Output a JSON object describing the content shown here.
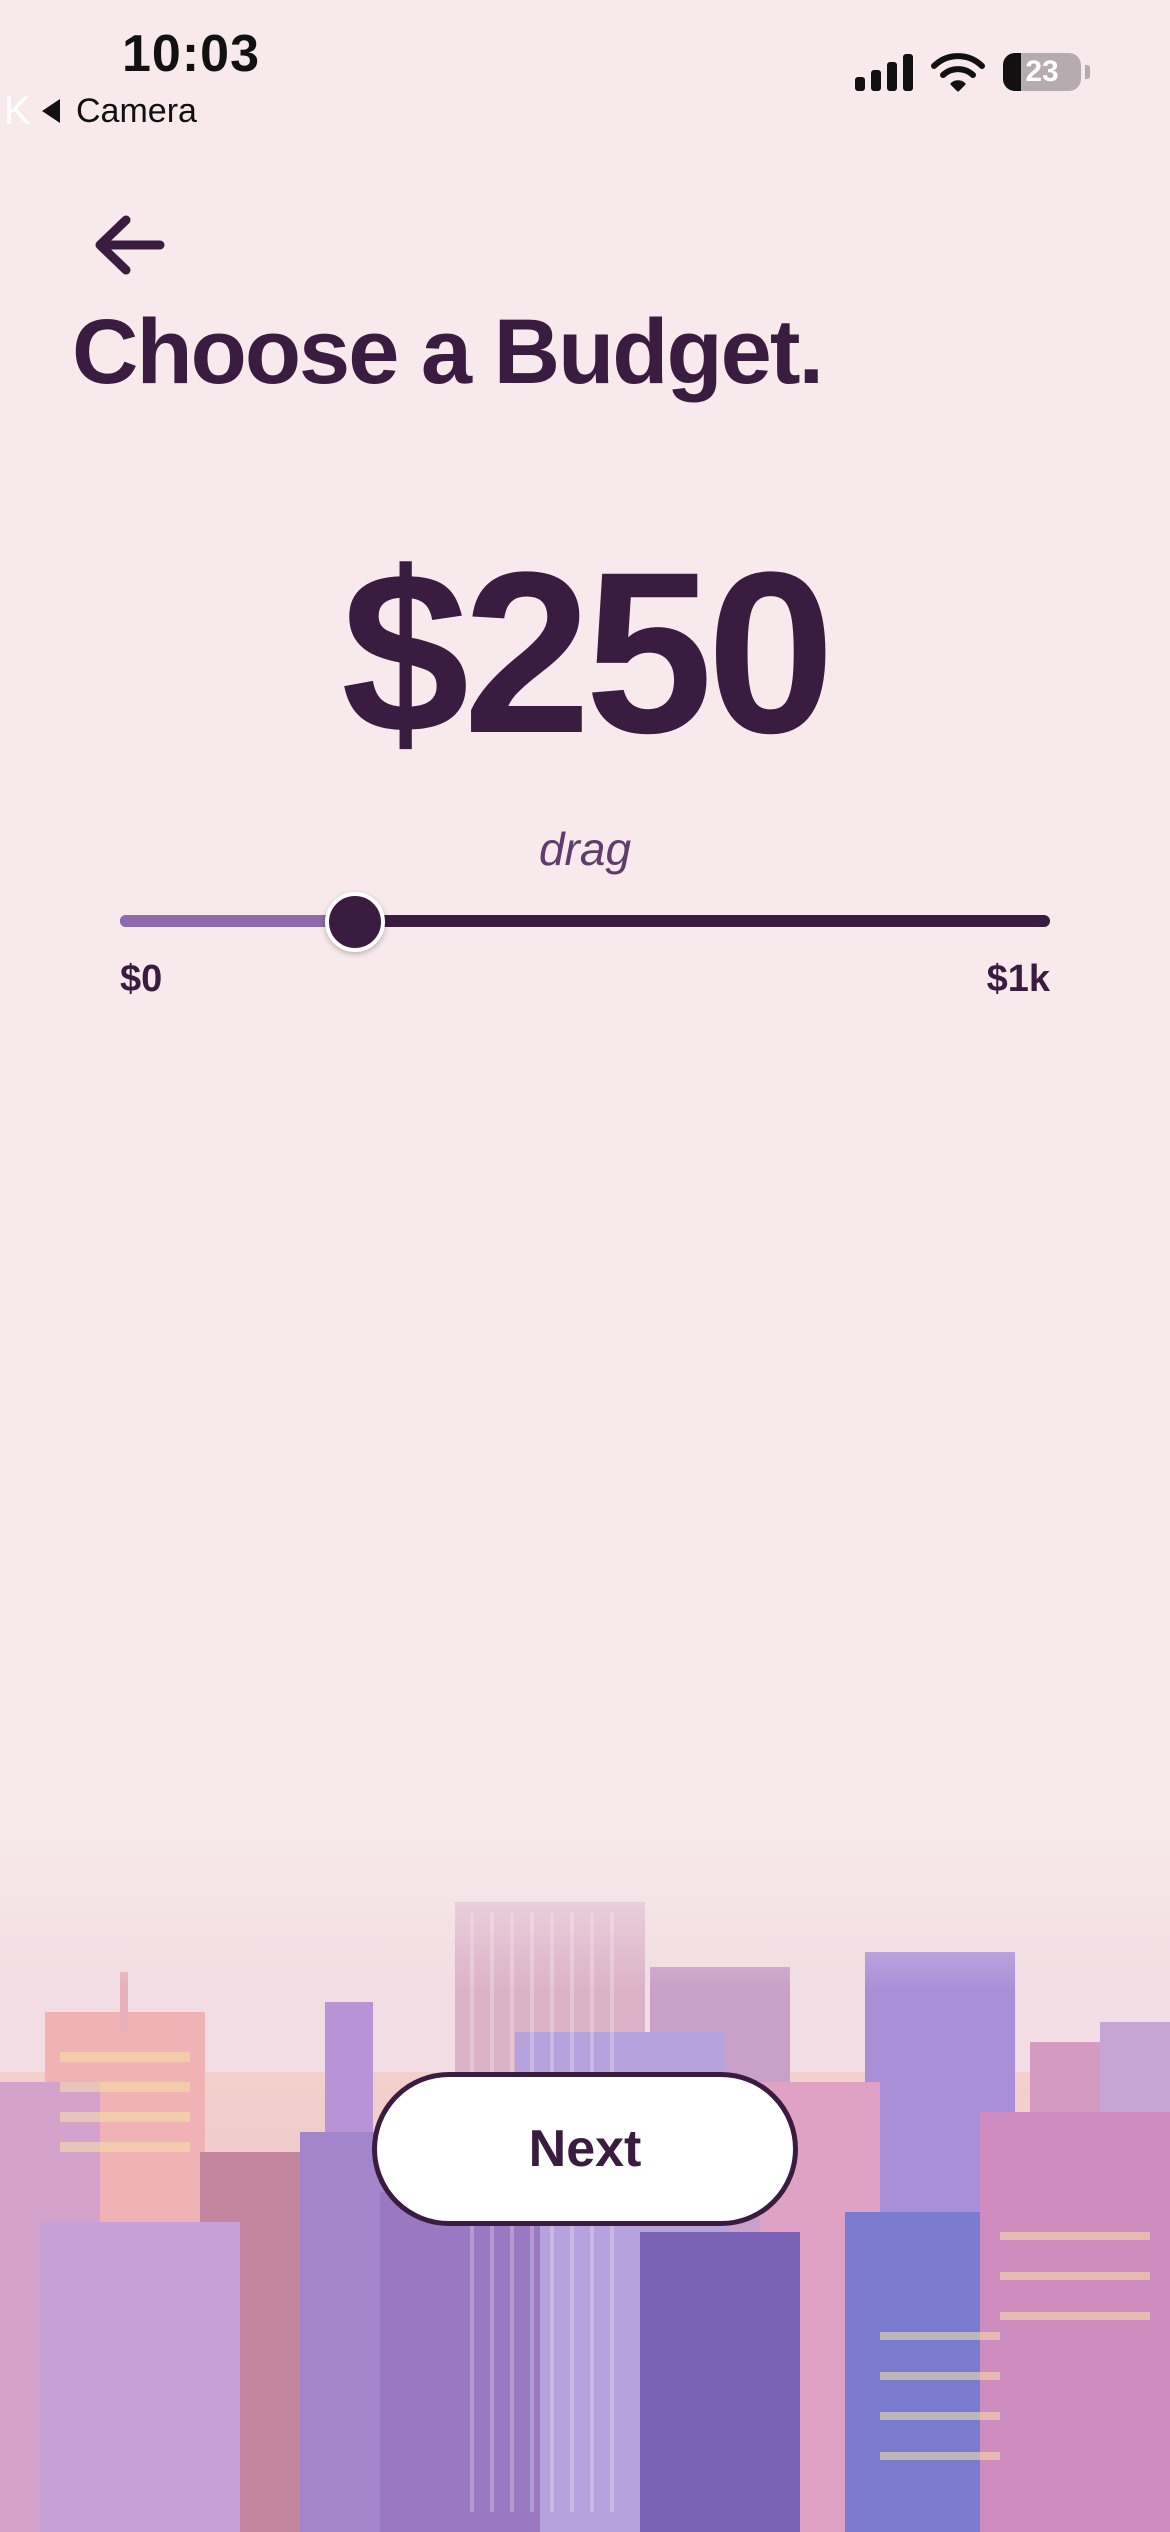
{
  "status_bar": {
    "time": "10:03",
    "back_app": "Camera",
    "back_glyph": "K",
    "battery_percent": "23",
    "battery_level": 0.23
  },
  "screen": {
    "title": "Choose a Budget.",
    "amount": "$250",
    "drag_hint": "drag"
  },
  "slider": {
    "value": 250,
    "min": 0,
    "max": 1000,
    "min_label": "$0",
    "max_label": "$1k"
  },
  "actions": {
    "next_label": "Next"
  },
  "icons": {
    "back": "arrow-left-icon",
    "signal": "cellular-signal-icon",
    "wifi": "wifi-icon",
    "battery": "battery-icon"
  },
  "colors": {
    "background": "#f8eaec",
    "primary": "#3a1c40",
    "accent": "#8e69ad",
    "button_bg": "#ffffff"
  }
}
